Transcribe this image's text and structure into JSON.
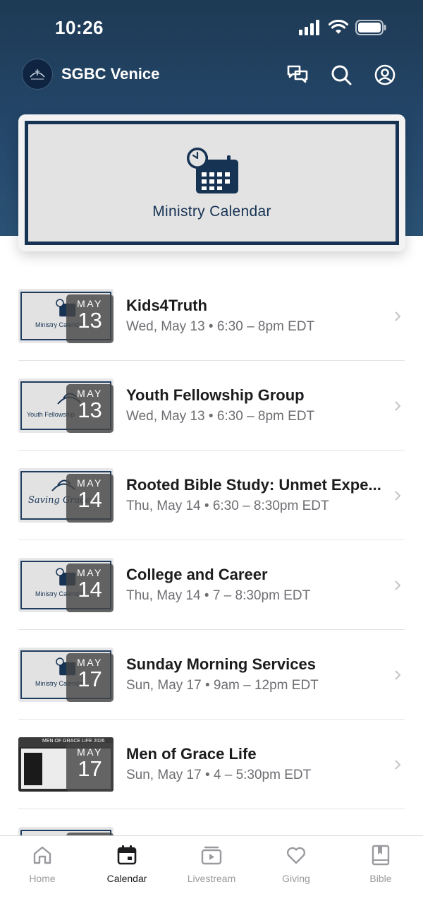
{
  "status": {
    "time": "10:26"
  },
  "app": {
    "title": "SGBC Venice"
  },
  "banner": {
    "label": "Ministry Calendar"
  },
  "events": [
    {
      "title": "Kids4Truth",
      "date": "Wed, May 13",
      "time": "6:30 – 8pm EDT",
      "month": "MAY",
      "day": "13",
      "thumb": "Ministry Calendar"
    },
    {
      "title": "Youth Fellowship Group",
      "date": "Wed, May 13",
      "time": "6:30 – 8pm EDT",
      "month": "MAY",
      "day": "13",
      "thumb": "Youth Fellowship"
    },
    {
      "title": "Rooted Bible Study: Unmet Expe...",
      "date": "Thu, May 14",
      "time": "6:30 – 8:30pm EDT",
      "month": "MAY",
      "day": "14",
      "thumb": "Saving Grace"
    },
    {
      "title": "College and Career",
      "date": "Thu, May 14",
      "time": "7 – 8:30pm EDT",
      "month": "MAY",
      "day": "14",
      "thumb": "Ministry Calendar"
    },
    {
      "title": "Sunday Morning Services",
      "date": "Sun, May 17",
      "time": "9am – 12pm EDT",
      "month": "MAY",
      "day": "17",
      "thumb": "Ministry Calendar"
    },
    {
      "title": "Men of Grace Life",
      "date": "Sun, May 17",
      "time": "4 – 5:30pm EDT",
      "month": "MAY",
      "day": "17",
      "thumb": "MEN OF GRACE LIFE 2026"
    }
  ],
  "tabs": [
    {
      "label": "Home",
      "icon": "home-icon"
    },
    {
      "label": "Calendar",
      "icon": "calendar-icon",
      "active": true
    },
    {
      "label": "Livestream",
      "icon": "livestream-icon"
    },
    {
      "label": "Giving",
      "icon": "heart-icon"
    },
    {
      "label": "Bible",
      "icon": "bible-icon"
    }
  ],
  "colors": {
    "header": "#1e3a55",
    "accent": "#163354",
    "muted": "#6e6e73"
  }
}
